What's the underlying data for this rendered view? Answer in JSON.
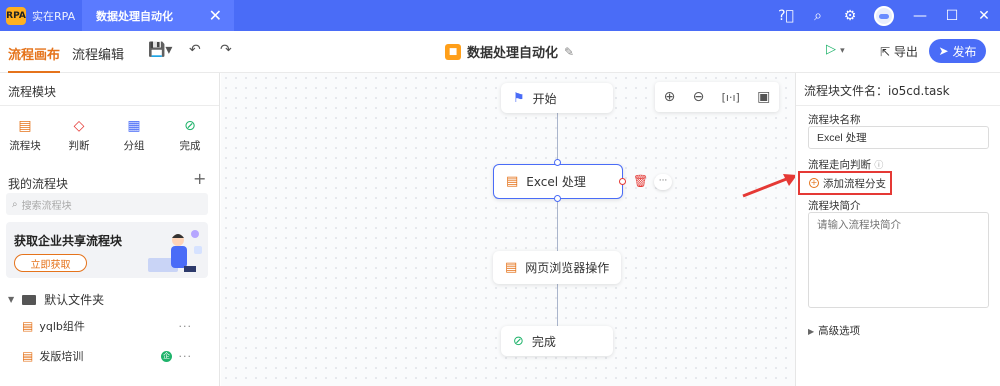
{
  "titlebar": {
    "app_name": "实在RPA",
    "app_logo_text": "RPA",
    "active_tab": "数据处理自动化",
    "close_glyph": "✕",
    "icons": [
      "help-icon",
      "search-icon",
      "settings-icon",
      "avatar",
      "minimize-icon",
      "maximize-icon",
      "close-icon"
    ],
    "bg_color": "#4a6cf7"
  },
  "toolbar": {
    "tab_canvas": "流程画布",
    "tab_editor": "流程编辑",
    "doc_title": "数据处理自动化",
    "export_label": "导出",
    "publish_label": "发布",
    "accent_color": "#e5731b"
  },
  "sidebar": {
    "title": "流程模块",
    "modules": [
      {
        "label": "流程块",
        "icon": "flow-block-icon"
      },
      {
        "label": "判断",
        "icon": "decision-icon"
      },
      {
        "label": "分组",
        "icon": "group-icon"
      },
      {
        "label": "完成",
        "icon": "complete-icon"
      }
    ],
    "my_blocks_title": "我的流程块",
    "search_placeholder": "搜索流程块",
    "banner_title": "获取企业共享流程块",
    "banner_button": "立即获取",
    "folder": "默认文件夹",
    "items": [
      {
        "label": "yqlb组件",
        "badge": ""
      },
      {
        "label": "发版培训",
        "badge": "企"
      }
    ]
  },
  "canvas": {
    "nodes": [
      {
        "label": "开始",
        "icon": "start-icon"
      },
      {
        "label": "Excel 处理",
        "icon": "flow-block-icon",
        "selected": true
      },
      {
        "label": "网页浏览器操作",
        "icon": "flow-block-icon"
      },
      {
        "label": "完成",
        "icon": "complete-icon"
      }
    ],
    "zoom_tools": [
      "zoom-in-icon",
      "zoom-out-icon",
      "fit-icon",
      "minimap-icon"
    ]
  },
  "panel": {
    "file_label": "流程块文件名：io5cd.task",
    "name_label": "流程块名称",
    "name_value": "Excel 处理",
    "branch_label": "流程走向判断",
    "add_branch": "添加流程分支",
    "desc_label": "流程块简介",
    "desc_placeholder": "请输入流程块简介",
    "advanced": "高级选项"
  }
}
